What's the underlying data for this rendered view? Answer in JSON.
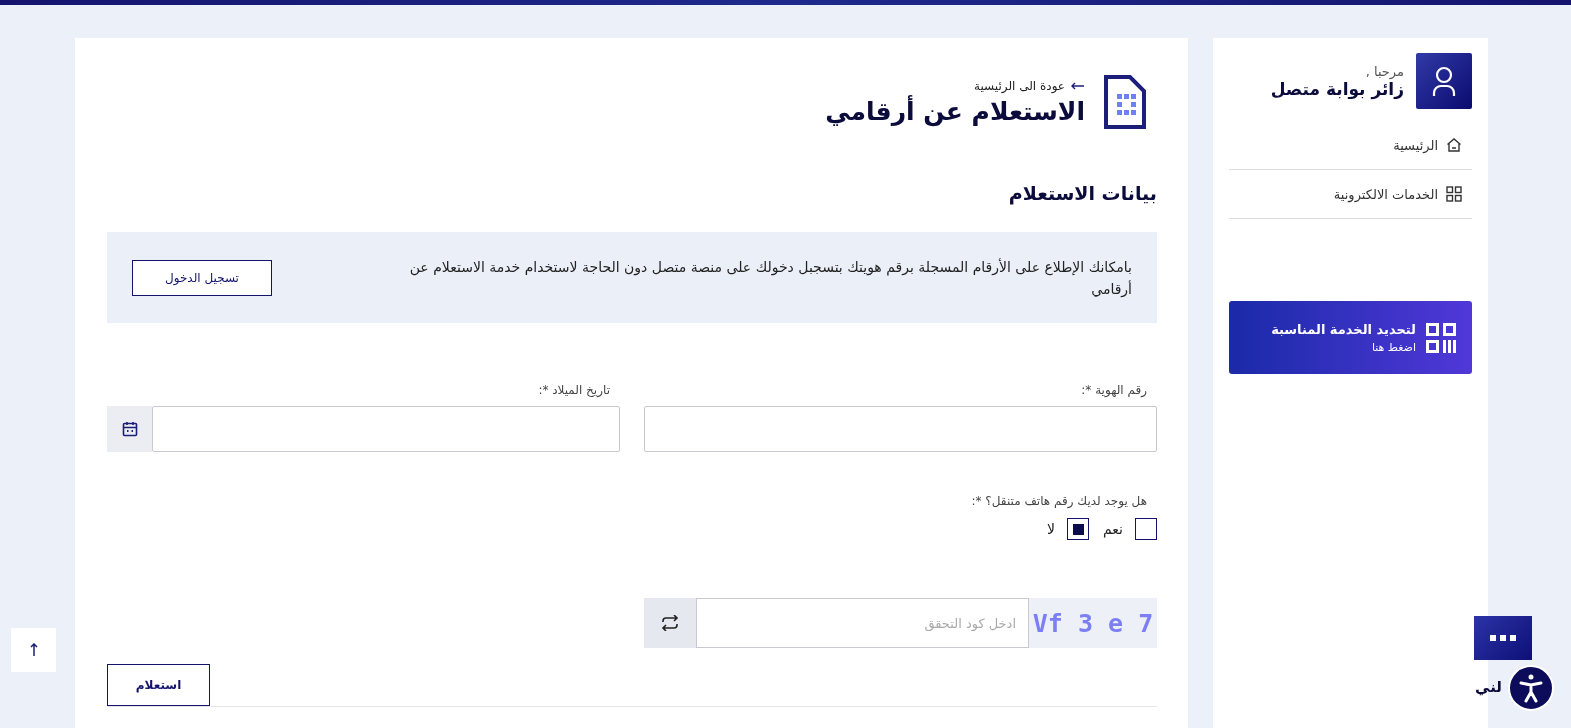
{
  "sidebar": {
    "greeting": "مرحبا ,",
    "user_name": "زائر بوابة متصل",
    "items": [
      {
        "label": "الرئيسية",
        "kind": "home",
        "selected": false
      },
      {
        "label": "الخدمات الالكترونية",
        "kind": "grid",
        "selected": false
      }
    ],
    "promo": {
      "title": "لتحديد الخدمة المناسبة",
      "link": "اضغط هنا"
    }
  },
  "header": {
    "back_link": "عودة الى الرئيسية",
    "title": "الاستعلام عن أرقامي"
  },
  "section_title": "بيانات الاستعلام",
  "notice": {
    "text": "بامكانك الإطلاع على الأرقام المسجلة برقم هويتك بتسجبل دخولك على منصة متصل دون الحاجة لاستخدام خدمة الاستعلام عن أرقامي",
    "button": "تسجيل الدخول"
  },
  "fields": [
    {
      "label": "رقم الهوية *:",
      "kind": "text"
    },
    {
      "label": "تاريخ الميلاد *:",
      "kind": "date"
    }
  ],
  "phone_question": {
    "label": "هل يوجد لديك رقم هاتف متنقل؟ *:",
    "options": [
      {
        "label": "نعم",
        "selected": false
      },
      {
        "label": "لا",
        "selected": true
      }
    ]
  },
  "captcha": {
    "code": "Vf 3 e 7",
    "placeholder": "ادخل كود التحقق"
  },
  "submit": "استعلام",
  "chat": {
    "label": "لني"
  }
}
